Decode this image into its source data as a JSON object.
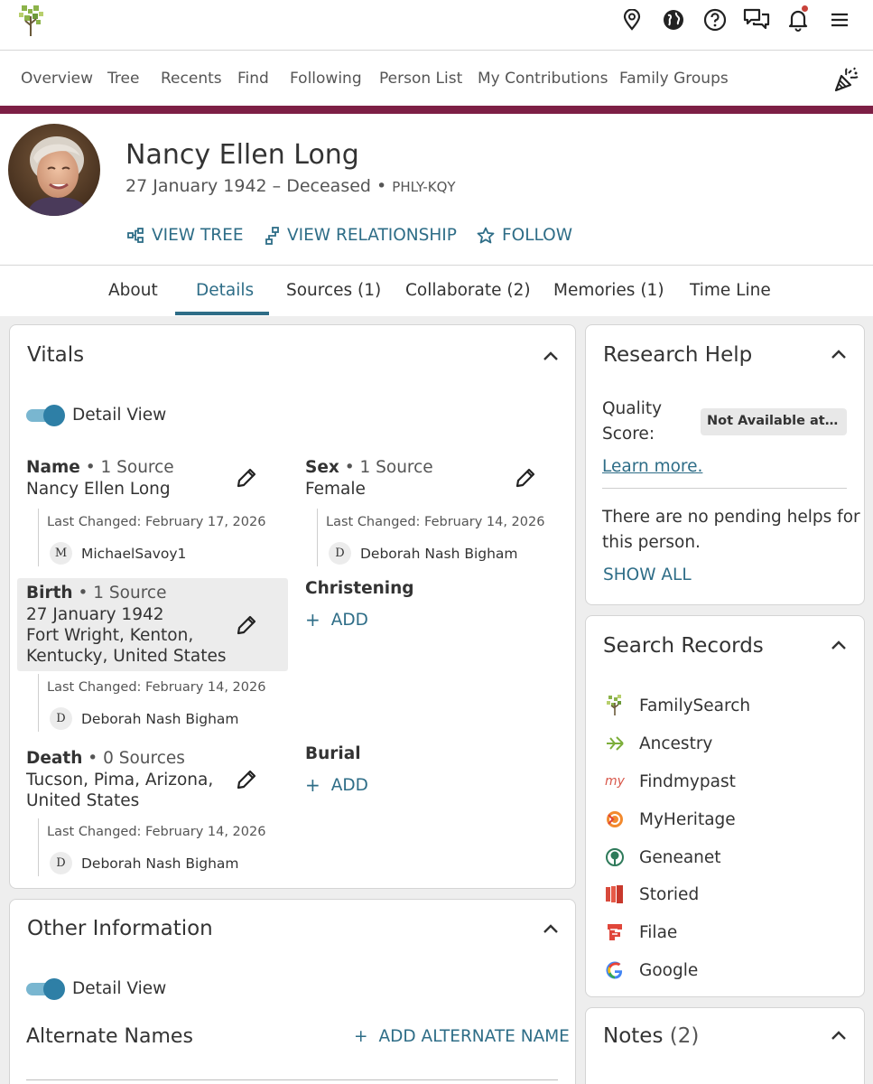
{
  "nav": {
    "items": [
      "Overview",
      "Tree",
      "Recents",
      "Find",
      "Following",
      "Person List",
      "My Contributions",
      "Family Groups"
    ]
  },
  "icons": {
    "top": [
      "map-pin-icon",
      "globe-icon",
      "help-icon",
      "messages-icon",
      "bell-icon",
      "menu-icon"
    ],
    "extra": "celebration-icon"
  },
  "person": {
    "name": "Nancy Ellen Long",
    "dates": "27 January 1942 – Deceased",
    "separator": "•",
    "id": "PHLY-KQY",
    "actions": [
      "VIEW TREE",
      "VIEW RELATIONSHIP",
      "FOLLOW"
    ]
  },
  "tabs": [
    "About",
    "Details",
    "Sources (1)",
    "Collaborate (2)",
    "Memories (1)",
    "Time Line"
  ],
  "vitals": {
    "title": "Vitals",
    "toggle_label": "Detail View",
    "name": {
      "label": "Name",
      "sources": "• 1 Source",
      "value": "Nancy Ellen Long",
      "changed": "Last Changed: February 17, 2026",
      "contributor_initial": "M",
      "contributor": "MichaelSavoy1"
    },
    "sex": {
      "label": "Sex",
      "sources": "• 1 Source",
      "value": "Female",
      "changed": "Last Changed: February 14, 2026",
      "contributor_initial": "D",
      "contributor": "Deborah Nash Bigham"
    },
    "birth": {
      "label": "Birth",
      "sources": "• 1 Source",
      "date": "27 January 1942",
      "place_line1": "Fort Wright, Kenton,",
      "place_line2": "Kentucky, United States",
      "changed": "Last Changed: February 14, 2026",
      "contributor_initial": "D",
      "contributor": "Deborah Nash Bigham"
    },
    "christening": {
      "label": "Christening",
      "add": "ADD"
    },
    "death": {
      "label": "Death",
      "sources": "• 0 Sources",
      "place_line1": "Tucson, Pima, Arizona,",
      "place_line2": "United States",
      "changed": "Last Changed: February 14, 2026",
      "contributor_initial": "D",
      "contributor": "Deborah Nash Bigham"
    },
    "burial": {
      "label": "Burial",
      "add": "ADD"
    }
  },
  "other_info": {
    "title": "Other Information",
    "toggle_label": "Detail View",
    "alternate_names": "Alternate Names",
    "add_alternate": "ADD ALTERNATE NAME"
  },
  "research_help": {
    "title": "Research Help",
    "quality_label_1": "Quality",
    "quality_label_2": "Score:",
    "quality_value": "Not Available at This Time",
    "learn_more": "Learn more.",
    "pending_line1": "There are no pending helps for",
    "pending_line2": "this person.",
    "show_all": "SHOW ALL"
  },
  "search_records": {
    "title": "Search Records",
    "items": [
      "FamilySearch",
      "Ancestry",
      "Findmypast",
      "MyHeritage",
      "Geneanet",
      "Storied",
      "Filae",
      "Google"
    ]
  },
  "notes": {
    "title": "Notes",
    "count": "(2)"
  },
  "colors": {
    "link": "#2e6d87",
    "maroon": "#7d1f45",
    "toggle": "#2e7fa6"
  }
}
